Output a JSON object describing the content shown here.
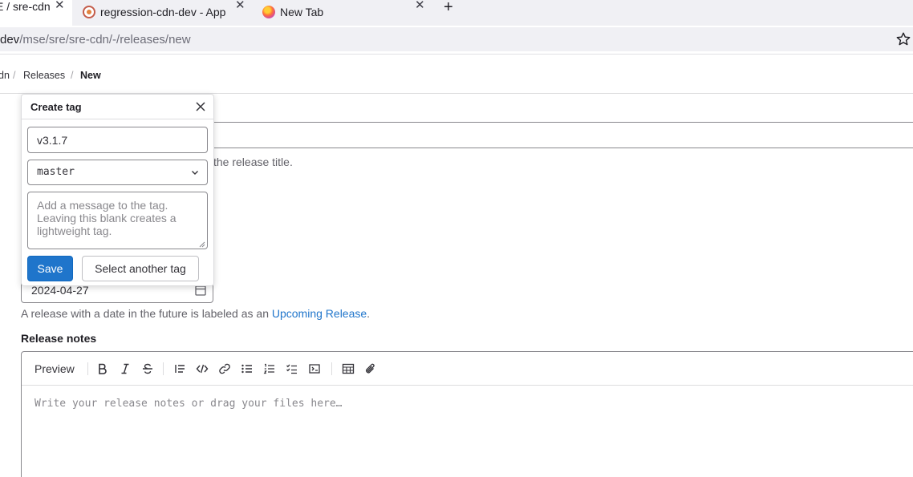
{
  "browser": {
    "tabs": [
      {
        "title": "E / sre-cdn",
        "active": true
      },
      {
        "title": "regression-cdn-dev - App",
        "icon": "gitlab-favicon-icon"
      },
      {
        "title": "New Tab",
        "icon": "firefox-icon"
      }
    ],
    "close_glyph": "✕",
    "new_tab_glyph": "+",
    "url_host": "dev",
    "url_path": "/mse/sre/sre-cdn/-/releases/new"
  },
  "breadcrumb": {
    "items": [
      "dn",
      "Releases",
      "New"
    ],
    "separator": "/"
  },
  "form": {
    "title_help": "the release title.",
    "date_value": "2024-04-27",
    "date_help_prefix": "A release with a date in the future is labeled as an ",
    "date_help_link": "Upcoming Release",
    "date_help_suffix": ".",
    "release_notes_label": "Release notes",
    "editor": {
      "preview_label": "Preview",
      "placeholder": "Write your release notes or drag your files here…",
      "toolbar_icons": [
        "bold-icon",
        "italic-icon",
        "strikethrough-icon",
        "quote-icon",
        "code-icon",
        "link-icon",
        "bullet-list-icon",
        "numbered-list-icon",
        "task-list-icon",
        "collapsible-icon",
        "table-icon",
        "attach-file-icon"
      ]
    }
  },
  "create_tag_popover": {
    "title": "Create tag",
    "tag_name_value": "v3.1.7",
    "ref_value": "master",
    "message_placeholder": "Add a message to the tag. Leaving this blank creates a lightweight tag.",
    "save_label": "Save",
    "select_another_label": "Select another tag"
  },
  "colors": {
    "primary": "#1f75cb",
    "link": "#1f75cb",
    "border": "#89888d"
  }
}
